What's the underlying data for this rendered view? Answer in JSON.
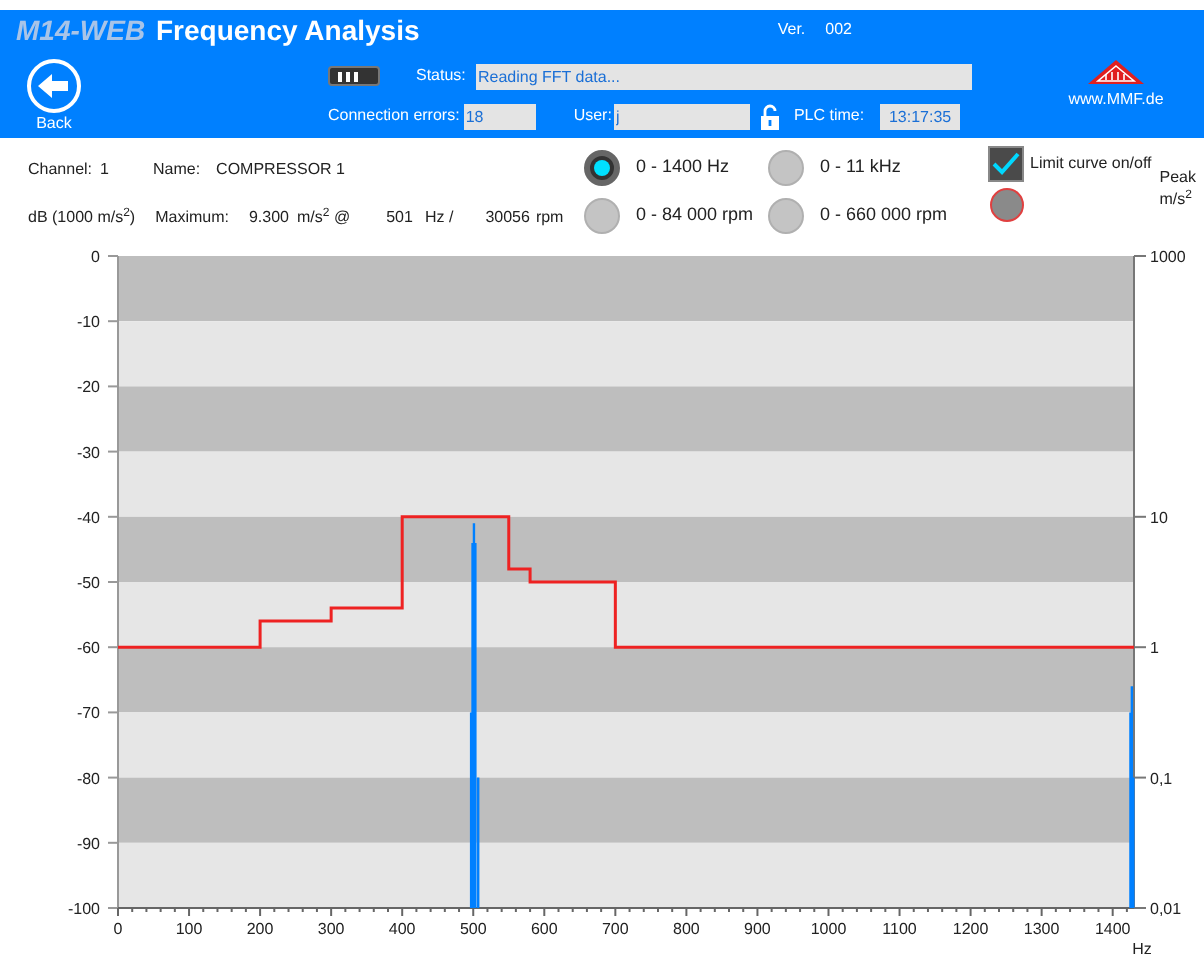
{
  "header": {
    "app_name": "M14-WEB",
    "title": "Frequency Analysis",
    "version_label": "Ver.",
    "version": "002",
    "back_label": "Back",
    "status_label": "Status:",
    "status_value": "Reading FFT data...",
    "connection_errors_label": "Connection errors:",
    "connection_errors": "18",
    "user_label": "User:",
    "user": "j",
    "plc_time_label": "PLC time:",
    "plc_time": "13:17:35",
    "website": "www.MMF.de"
  },
  "info": {
    "channel_label": "Channel:",
    "channel": "1",
    "name_label": "Name:",
    "name": "COMPRESSOR 1",
    "unit_label": "dB (1000 m/s$^{2}$)",
    "maximum_label": "Maximum:",
    "max_value": "9.300",
    "max_unit": "m/s$^{2}$ @",
    "max_freq": "501",
    "freq_unit": "Hz /",
    "max_rpm": "30056",
    "rpm_unit": "rpm"
  },
  "ranges": [
    {
      "label": "0 - 1400 Hz",
      "selected": true
    },
    {
      "label": "0 - 11 kHz",
      "selected": false
    },
    {
      "label": "0 - 84 000 rpm",
      "selected": false
    },
    {
      "label": "0 - 660 000 rpm",
      "selected": false
    }
  ],
  "limit_curve": {
    "label": "Limit curve on/off",
    "checked": true
  },
  "right_axis": {
    "title": [
      "Peak",
      "m/s$^{2}$"
    ],
    "ticks": [
      "1000",
      "10",
      "1",
      "0,1",
      "0,01"
    ]
  },
  "chart_data": {
    "type": "line",
    "xlabel": "Hz",
    "xlim": [
      0,
      1430
    ],
    "ylim": [
      -100,
      0
    ],
    "grid": true,
    "xticks": [
      0,
      100,
      200,
      300,
      400,
      500,
      600,
      700,
      800,
      900,
      1000,
      1100,
      1200,
      1300,
      1400
    ],
    "yticks": [
      0,
      -10,
      -20,
      -30,
      -40,
      -50,
      -60,
      -70,
      -80,
      -90,
      -100
    ],
    "series": [
      {
        "color": "#ee2222",
        "x": [
          0,
          200,
          200,
          300,
          300,
          400,
          400,
          550,
          550,
          580,
          580,
          700,
          700,
          1430
        ],
        "values": [
          -60,
          -60,
          -56,
          -56,
          -54,
          -54,
          -40,
          -40,
          -48,
          -48,
          -50,
          -50,
          -60,
          -60
        ]
      }
    ]
  }
}
